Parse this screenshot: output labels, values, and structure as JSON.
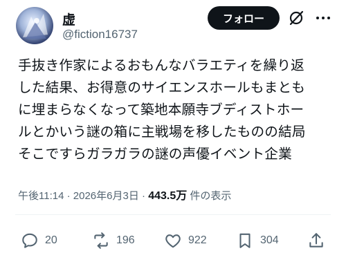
{
  "user": {
    "display_name": "虚",
    "handle": "@fiction16737",
    "avatar_icon": "avatar-image"
  },
  "header": {
    "follow_label": "フォロー",
    "grok_icon": "grok-slash-icon",
    "more_icon": "more-dots-icon"
  },
  "tweet": {
    "text": "手抜き作家によるおもんなバラエティを繰り返\nした結果、お得意のサイエンスホールもまとも\nに埋まらなくなって築地本願寺ブディストホー\nルとかいう謎の箱に主戦場を移したものの結局\nそこですらガラガラの謎の声優イベント企業"
  },
  "meta": {
    "time": "午後11:14",
    "separator": "·",
    "date": "2026年6月3日",
    "separator2": "·",
    "views": "443.5万",
    "views_label": "件の表示"
  },
  "actions": {
    "replies": "20",
    "reposts": "196",
    "likes": "922",
    "bookmarks": "304"
  },
  "colors": {
    "text": "#0f1419",
    "secondary": "#536471",
    "follow_bg": "#0f1419"
  }
}
